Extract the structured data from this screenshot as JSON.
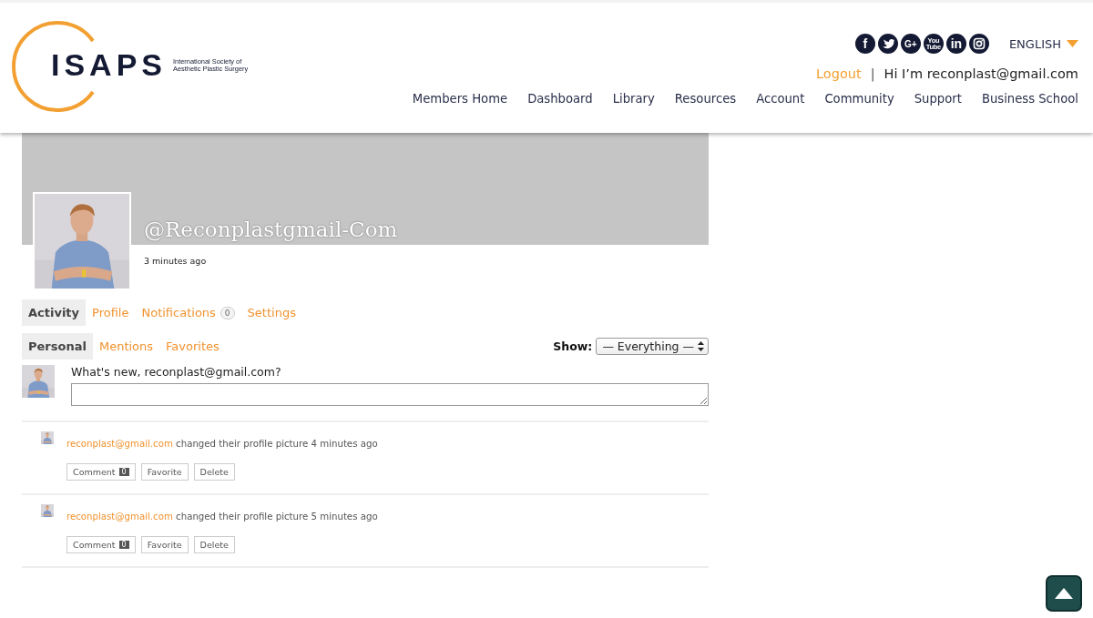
{
  "header": {
    "logo": {
      "mark": "ISAPS",
      "tagline": [
        "International Society of",
        "Aesthetic Plastic Surgery"
      ]
    },
    "social": [
      {
        "kind": "facebook",
        "glyph": "f"
      },
      {
        "kind": "twitter"
      },
      {
        "kind": "googleplus",
        "glyph": "G+"
      },
      {
        "kind": "youtube",
        "glyph": "You Tube"
      },
      {
        "kind": "linkedin",
        "glyph": "in"
      },
      {
        "kind": "instagram"
      }
    ],
    "language": "ENGLISH",
    "logout": "Logout",
    "separator": "|",
    "greeting": "Hi I’m reconplast@gmail.com",
    "nav": [
      "Members Home",
      "Dashboard",
      "Library",
      "Resources",
      "Account",
      "Community",
      "Support",
      "Business School"
    ]
  },
  "profile": {
    "handle": "@Reconplastgmail-Com",
    "last_active": "3 minutes ago"
  },
  "tabs": [
    {
      "label": "Activity",
      "selected": true
    },
    {
      "label": "Profile",
      "selected": false
    },
    {
      "label": "Notifications",
      "selected": false,
      "count": "0"
    },
    {
      "label": "Settings",
      "selected": false
    }
  ],
  "subtabs": [
    {
      "label": "Personal",
      "selected": true
    },
    {
      "label": "Mentions",
      "selected": false
    },
    {
      "label": "Favorites",
      "selected": false
    }
  ],
  "filter": {
    "label": "Show:",
    "value": "— Everything —"
  },
  "post_form": {
    "prompt": "What's new, reconplast@gmail.com?"
  },
  "activities": [
    {
      "user": "reconplast@gmail.com",
      "text": "changed their profile picture 4 minutes ago",
      "buttons": [
        {
          "label": "Comment",
          "count": "0"
        },
        {
          "label": "Favorite"
        },
        {
          "label": "Delete"
        }
      ]
    },
    {
      "user": "reconplast@gmail.com",
      "text": "changed their profile picture 5 minutes ago",
      "buttons": [
        {
          "label": "Comment",
          "count": "0"
        },
        {
          "label": "Favorite"
        },
        {
          "label": "Delete"
        }
      ]
    }
  ]
}
